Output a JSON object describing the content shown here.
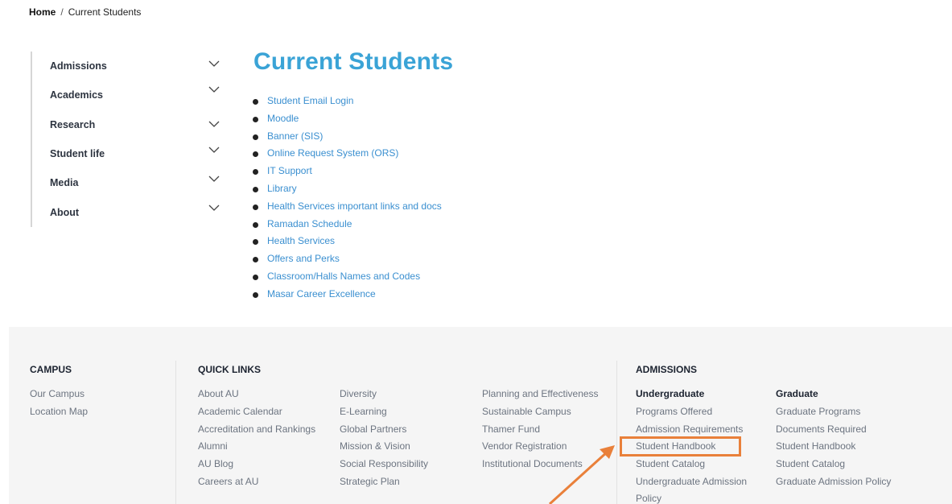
{
  "breadcrumb": {
    "home": "Home",
    "separator": "/",
    "current": "Current Students"
  },
  "sidebar": {
    "items": [
      {
        "label": "Admissions"
      },
      {
        "label": "Academics"
      },
      {
        "label": "Research"
      },
      {
        "label": "Student life"
      },
      {
        "label": "Media"
      },
      {
        "label": "About"
      }
    ],
    "chevron_icon": "chevron-down-icon"
  },
  "main": {
    "title": "Current Students",
    "links": [
      "Student Email Login",
      "Moodle",
      "Banner (SIS)",
      "Online Request System (ORS)",
      "IT Support",
      "Library",
      "Health Services important links and docs",
      "Ramadan Schedule",
      "Health Services",
      "Offers and Perks",
      "Classroom/Halls Names and Codes",
      "Masar Career Excellence"
    ]
  },
  "footer": {
    "campus": {
      "heading": "CAMPUS",
      "links": [
        "Our Campus",
        "Location Map"
      ]
    },
    "quick_links": {
      "heading": "QUICK LINKS",
      "col1": [
        "About AU",
        "Academic Calendar",
        "Accreditation and Rankings",
        "Alumni",
        "AU Blog",
        "Careers at AU"
      ],
      "col2": [
        "Diversity",
        "E-Learning",
        "Global Partners",
        "Mission & Vision",
        "Social Responsibility",
        "Strategic Plan"
      ],
      "col3": [
        "Planning and Effectiveness",
        "Sustainable Campus",
        "Thamer Fund",
        "Vendor Registration",
        "Institutional Documents"
      ]
    },
    "admissions": {
      "heading": "ADMISSIONS",
      "undergraduate": {
        "title": "Undergraduate",
        "links": [
          "Programs Offered",
          "Admission Requirements",
          "Student Handbook",
          "Student Catalog",
          "Undergraduate Admission",
          "Policy"
        ]
      },
      "graduate": {
        "title": "Graduate",
        "links": [
          "Graduate Programs",
          "Documents Required",
          "Student Handbook",
          "Student Catalog",
          "Graduate Admission Policy"
        ]
      }
    }
  },
  "annotation": {
    "color": "#e9803a"
  },
  "colors": {
    "title": "#3aa3d6",
    "link": "#3a8fd0",
    "footer_bg": "#f5f5f5"
  }
}
